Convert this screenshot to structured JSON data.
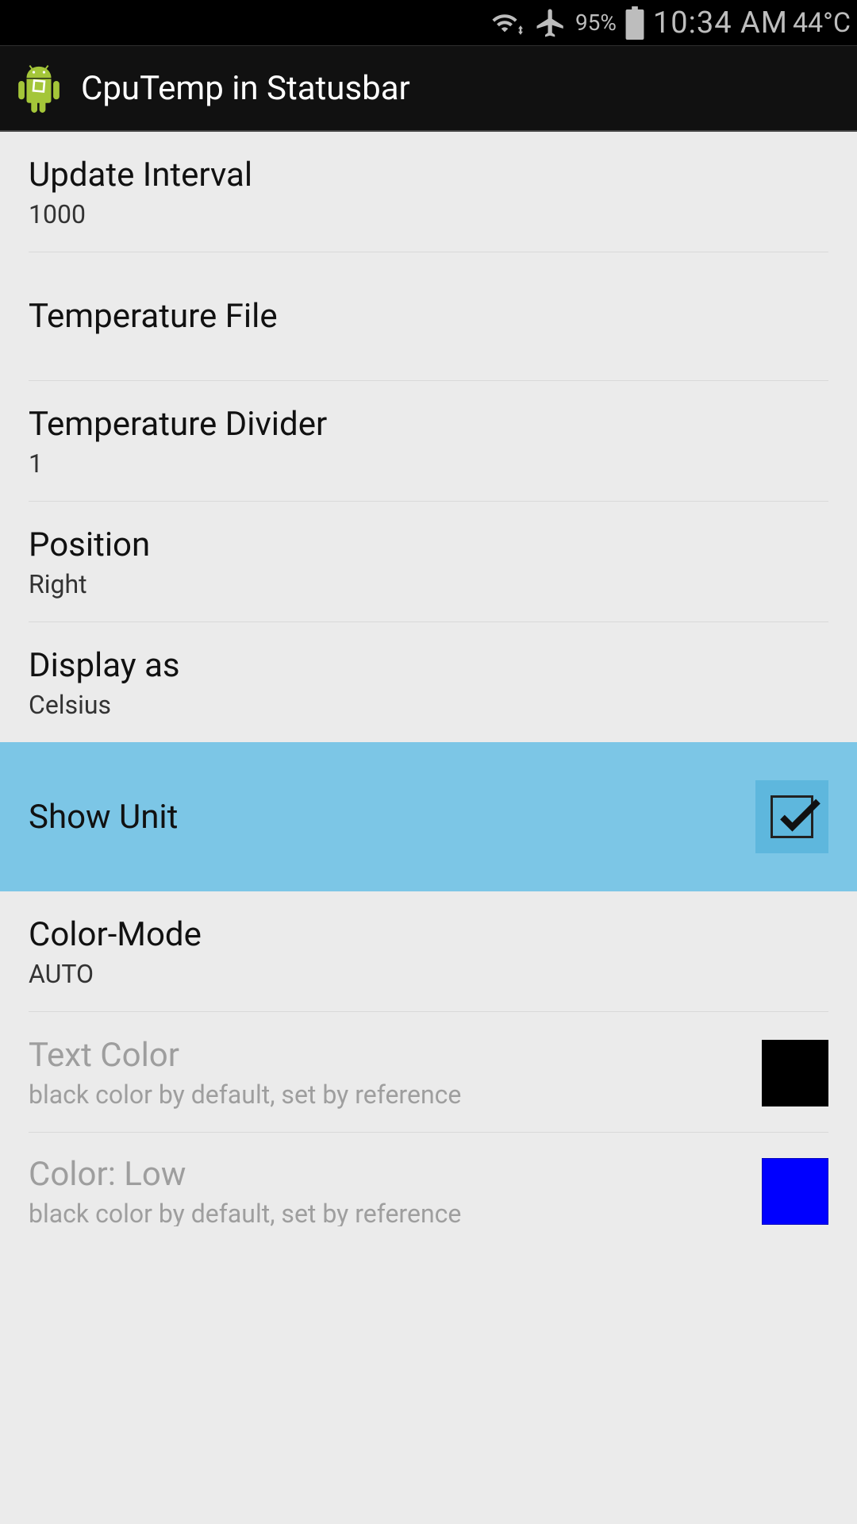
{
  "statusbar": {
    "battery_pct": "95%",
    "time": "10:34 AM",
    "temp": "44°C"
  },
  "actionbar": {
    "title": "CpuTemp in Statusbar"
  },
  "settings": {
    "update_interval": {
      "title": "Update Interval",
      "value": "1000"
    },
    "temp_file": {
      "title": "Temperature File"
    },
    "temp_divider": {
      "title": "Temperature Divider",
      "value": "1"
    },
    "position": {
      "title": "Position",
      "value": "Right"
    },
    "display_as": {
      "title": "Display as",
      "value": "Celsius"
    },
    "show_unit": {
      "title": "Show Unit",
      "checked": true
    },
    "color_mode": {
      "title": "Color-Mode",
      "value": "AUTO"
    },
    "text_color": {
      "title": "Text Color",
      "subtitle": "black color by default, set by reference",
      "swatch": "#000000"
    },
    "color_low": {
      "title": "Color: Low",
      "subtitle": "black color by default, set by reference",
      "swatch": "#0000ff"
    }
  }
}
